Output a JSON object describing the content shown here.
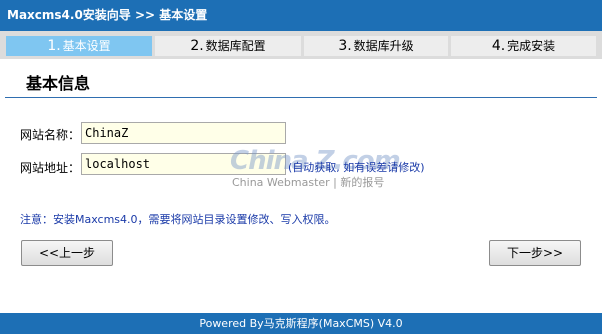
{
  "header": {
    "title": "Maxcms4.0安装向导 >> 基本设置"
  },
  "steps": [
    {
      "num": "1.",
      "label": "基本设置"
    },
    {
      "num": "2.",
      "label": "数据库配置"
    },
    {
      "num": "3.",
      "label": "数据库升级"
    },
    {
      "num": "4.",
      "label": "完成安装"
    }
  ],
  "active_step": 1,
  "section": {
    "title": "基本信息"
  },
  "form": {
    "site_name_label": "网站名称：",
    "site_name_value": "ChinaZ",
    "site_url_label": "网站地址：",
    "site_url_value": "localhost",
    "site_url_hint": "(自动获取, 如有误差请修改)"
  },
  "watermark": {
    "logo": "China Z.com",
    "subtitle": "China Webmaster | 新的报号"
  },
  "notice": "注意：安装Maxcms4.0，需要将网站目录设置修改、写入权限。",
  "buttons": {
    "prev": "<<上一步",
    "next": "下一步>>"
  },
  "footer": "Powered By马克斯程序(MaxCMS) V4.0",
  "colors": {
    "primary": "#1d6fb5",
    "active_step": "#7fc6f1",
    "notice_text": "#1a3aa8"
  }
}
